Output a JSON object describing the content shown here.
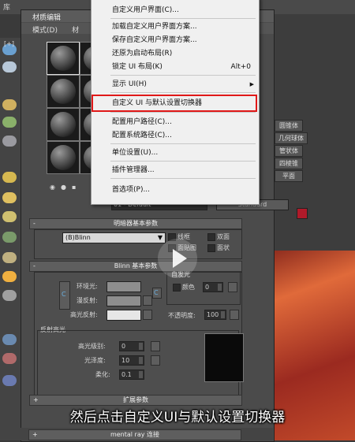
{
  "app": {
    "top_label": "库",
    "editor_title": "材质编辑",
    "menu_items": [
      "模式(D)",
      "材"
    ],
    "viewport_tag": "[+]"
  },
  "context_menu": {
    "items": [
      {
        "label": "自定义用户界面(C)...",
        "shortcut": "",
        "submenu": false
      },
      {
        "label": "加载自定义用户界面方案...",
        "shortcut": "",
        "submenu": false
      },
      {
        "label": "保存自定义用户界面方案...",
        "shortcut": "",
        "submenu": false
      },
      {
        "label": "还原为启动布局(R)",
        "shortcut": "",
        "submenu": false
      },
      {
        "label": "锁定 UI 布局(K)",
        "shortcut": "Alt+0",
        "submenu": false
      },
      {
        "label": "显示 UI(H)",
        "shortcut": "",
        "submenu": true
      },
      {
        "label": "自定义 UI 与默认设置切换器",
        "shortcut": "",
        "submenu": false
      },
      {
        "label": "配置用户路径(C)...",
        "shortcut": "",
        "submenu": false
      },
      {
        "label": "配置系统路径(C)...",
        "shortcut": "",
        "submenu": false
      },
      {
        "label": "单位设置(U)...",
        "shortcut": "",
        "submenu": false
      },
      {
        "label": "插件管理器...",
        "shortcut": "",
        "submenu": false
      },
      {
        "label": "首选项(P)...",
        "shortcut": "",
        "submenu": false
      }
    ]
  },
  "material": {
    "name": "01 - Default",
    "type": "Standard",
    "shader_rollout": "明暗器基本参数",
    "shader_type": "(B)Blinn",
    "options": [
      "线框",
      "双面",
      "面贴图",
      "面状"
    ],
    "blinn_rollout": "Blinn 基本参数",
    "self_illum_group": "自发光",
    "self_illum_color_label": "颜色",
    "self_illum_value": "0",
    "ambient_label": "环境光:",
    "diffuse_label": "漫反射:",
    "specular_label": "高光反射:",
    "opacity_label": "不透明度:",
    "opacity_value": "100",
    "spec_highlights_group": "反射高光",
    "spec_level_label": "高光级别:",
    "spec_level_value": "0",
    "glossiness_label": "光泽度:",
    "glossiness_value": "10",
    "soften_label": "柔化:",
    "soften_value": "0.1",
    "extended_rollout": "扩展参数",
    "mentalray_rollout": "mental ray 连接",
    "lock_icon_char": "C",
    "map_btn_char": "M"
  },
  "right_panel": {
    "primitives": [
      "圆锥体",
      "几何球体",
      "管状体",
      "四棱锥",
      "平面"
    ]
  },
  "subtitle": "然后点击自定义UI与默认设置切换器",
  "colors": {
    "highlight": "#e01818",
    "menu_bg": "#f0f0f0"
  }
}
